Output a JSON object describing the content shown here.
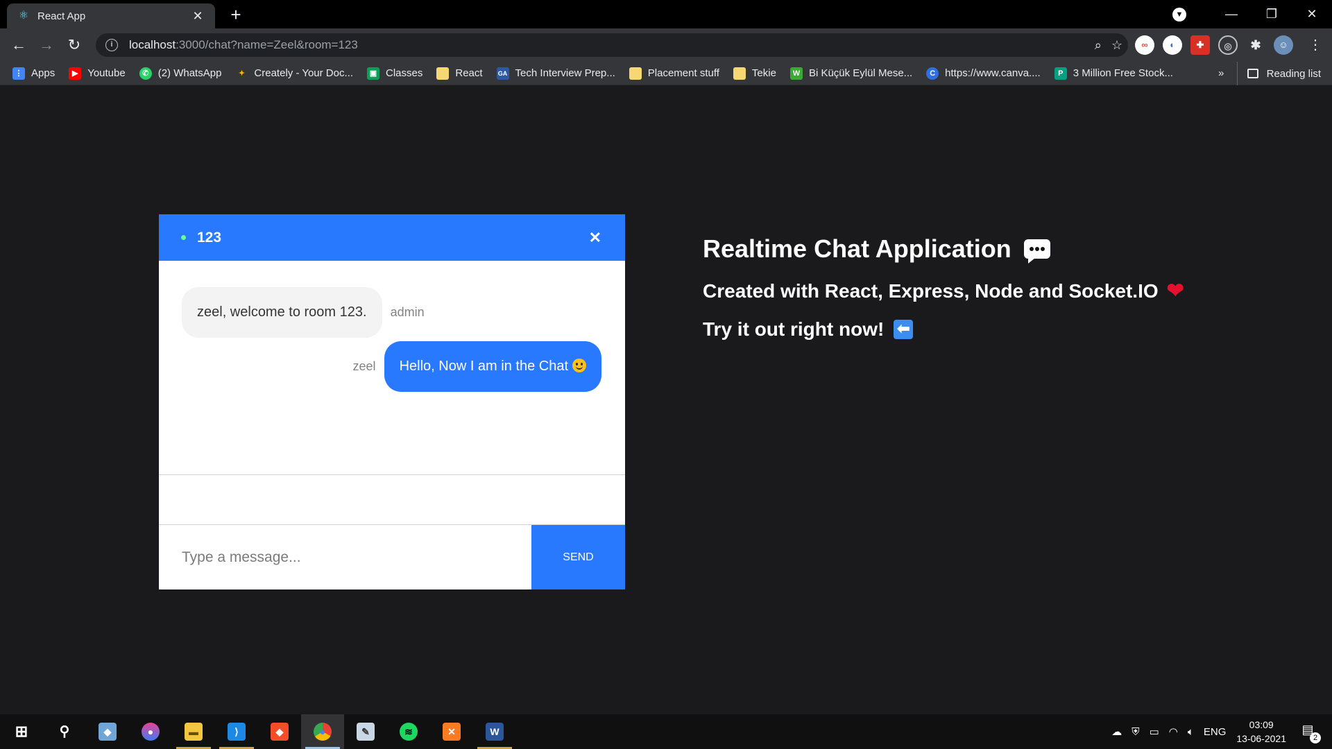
{
  "browser": {
    "tab_title": "React App",
    "url_host": "localhost",
    "url_rest": ":3000/chat?name=Zeel&room=123",
    "bookmarks": [
      {
        "label": "Apps",
        "icon": "apps-grid-icon",
        "color": "#4285f4"
      },
      {
        "label": "Youtube",
        "icon": "youtube-icon",
        "color": "#ff0000"
      },
      {
        "label": "(2) WhatsApp",
        "icon": "whatsapp-icon",
        "color": "#25d366"
      },
      {
        "label": "Creately - Your Doc...",
        "icon": "creately-icon",
        "color": "#f4b400"
      },
      {
        "label": "Classes",
        "icon": "classroom-icon",
        "color": "#0f9d58"
      },
      {
        "label": "React",
        "icon": "folder-icon",
        "color": "#f7d774"
      },
      {
        "label": "Tech Interview Prep...",
        "icon": "ga-icon",
        "color": "#2c5aa0"
      },
      {
        "label": "Placement stuff",
        "icon": "folder-icon",
        "color": "#f7d774"
      },
      {
        "label": "Tekie",
        "icon": "folder-icon",
        "color": "#f7d774"
      },
      {
        "label": "Bi Küçük Eylül Mese...",
        "icon": "w-icon",
        "color": "#3aaa35"
      },
      {
        "label": "https://www.canva....",
        "icon": "canva-icon",
        "color": "#2f6fdf"
      },
      {
        "label": "3 Million Free Stock...",
        "icon": "stock-icon",
        "color": "#05a081"
      }
    ],
    "more_label": "»",
    "reading_list": "Reading list"
  },
  "chat": {
    "room": "123",
    "messages": [
      {
        "text": "zeel, welcome to room 123.",
        "sender": "admin"
      },
      {
        "text": "Hello, Now I am in the Chat",
        "sender": "zeel"
      }
    ],
    "input_placeholder": "Type a message...",
    "send_label": "Send"
  },
  "info": {
    "title": "Realtime Chat Application",
    "subtitle": "Created with React, Express, Node and Socket.IO",
    "cta": "Try it out right now!"
  },
  "taskbar": {
    "apps": [
      "windows-start-icon",
      "search-icon",
      "virtualbox-icon",
      "blender-drop-icon",
      "file-explorer-icon",
      "vscode-icon",
      "git-icon",
      "chrome-icon",
      "paint-icon",
      "spotify-icon",
      "xampp-icon",
      "word-icon"
    ],
    "language": "ENG",
    "time": "03:09",
    "date": "13-06-2021",
    "notifications": "2"
  },
  "colors": {
    "accent": "#2979ff",
    "page_bg": "#1a1a1d",
    "online": "#66ff99"
  }
}
